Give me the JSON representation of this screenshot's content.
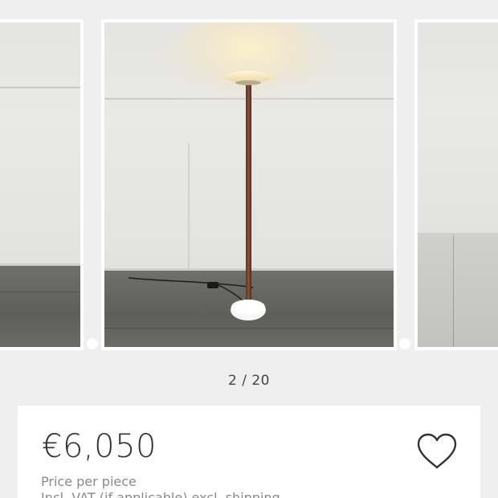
{
  "carousel": {
    "counter": "2 / 20",
    "slides": [
      {
        "name": "previous-photo"
      },
      {
        "name": "current-photo"
      },
      {
        "name": "next-photo"
      }
    ]
  },
  "listing": {
    "price": "€6,050",
    "price_note": "Price per piece",
    "vat_note": "Incl. VAT (if applicable) excl. shipping"
  },
  "icons": {
    "favorite": "heart-outline-icon"
  },
  "colors": {
    "background": "#efefef",
    "card": "#ffffff",
    "price_text": "#333333",
    "secondary_text": "#8a8a8a"
  }
}
